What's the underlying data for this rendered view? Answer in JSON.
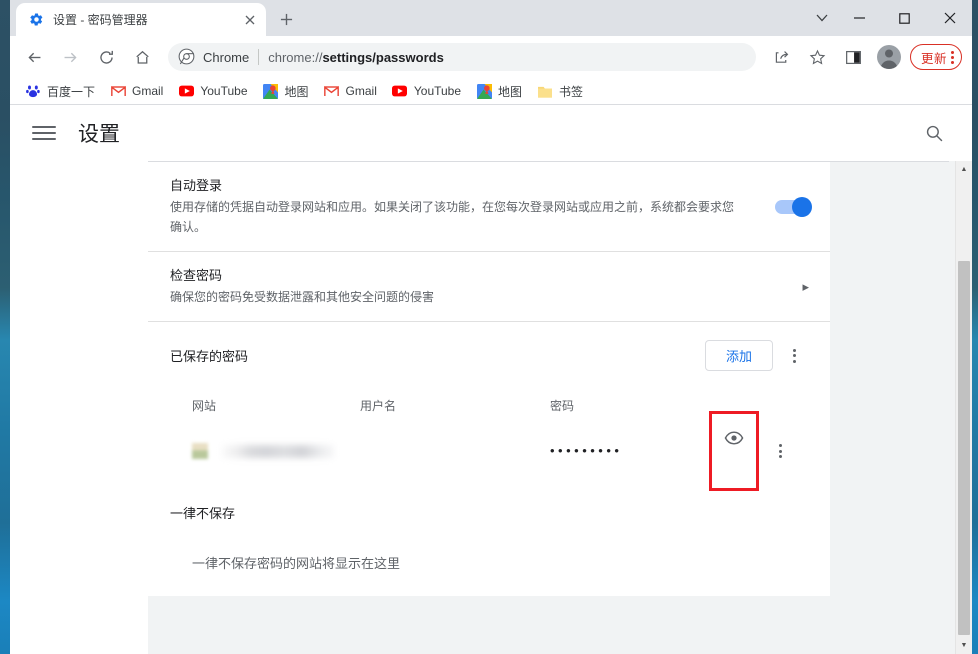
{
  "browser": {
    "tab": {
      "title": "设置 - 密码管理器",
      "favicon": "gear-icon",
      "close_label": "✕"
    },
    "newtab_label": "+",
    "window_controls": {
      "tab_search": "chevron-down-icon",
      "minimize": "—",
      "maximize": "□",
      "close": "✕"
    },
    "toolbar": {
      "back": "←",
      "forward": "→",
      "reload": "⟳",
      "home": "⌂",
      "omnibox": {
        "chrome_icon": "chrome-icon",
        "chrome_label": "Chrome",
        "url_prefix": "chrome://",
        "url_bold": "settings/passwords"
      },
      "share": "share-icon",
      "bookmark_star": "star-icon",
      "side_panel": "side-panel-icon",
      "avatar": "profile-avatar-icon",
      "update_label": "更新",
      "menu": "three-dot-menu-icon"
    },
    "bookmarks": [
      {
        "icon": "baidu-icon",
        "label": "百度一下"
      },
      {
        "icon": "gmail-icon",
        "label": "Gmail"
      },
      {
        "icon": "youtube-icon",
        "label": "YouTube"
      },
      {
        "icon": "maps-icon",
        "label": "地图"
      },
      {
        "icon": "gmail-icon",
        "label": "Gmail"
      },
      {
        "icon": "youtube-icon",
        "label": "YouTube"
      },
      {
        "icon": "maps-icon",
        "label": "地图"
      },
      {
        "icon": "folder-icon",
        "label": "书签"
      }
    ]
  },
  "settings": {
    "header": {
      "menu_icon": "hamburger-icon",
      "title": "设置",
      "search_icon": "search-icon"
    },
    "autosignin": {
      "title": "自动登录",
      "description": "使用存储的凭据自动登录网站和应用。如果关闭了该功能，在您每次登录网站或应用之前，系统都会要求您确认。",
      "toggle_on": true,
      "toggle_color": "#1a73e8"
    },
    "check_passwords": {
      "title": "检查密码",
      "description": "确保您的密码免受数据泄露和其他安全问题的侵害",
      "chevron": "▸"
    },
    "saved_passwords": {
      "title": "已保存的密码",
      "add_label": "添加",
      "add_color": "#1a73e8",
      "menu_icon": "three-dot-menu-icon",
      "columns": [
        "网站",
        "用户名",
        "密码"
      ],
      "rows": [
        {
          "site": "",
          "username": "",
          "password_mask": "•••••••••",
          "show_password_icon": "eye-icon",
          "row_menu_icon": "three-dot-menu-icon",
          "highlighted": true,
          "highlight_color": "#ee1b24"
        }
      ]
    },
    "never_saved": {
      "title": "一律不保存",
      "empty_text": "一律不保存密码的网站将显示在这里"
    },
    "scrollbar": {
      "up_arrow": "▲",
      "down_arrow": "▼"
    }
  }
}
